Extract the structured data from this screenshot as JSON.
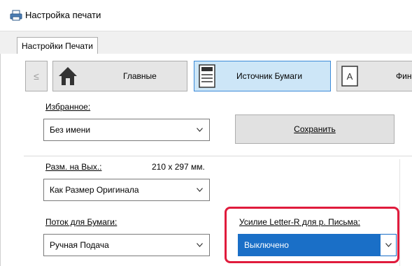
{
  "window": {
    "title": "Настройка печати",
    "icon": "printer-icon"
  },
  "tabs": [
    {
      "label": "Настройки Печати",
      "selected": true
    }
  ],
  "nav": {
    "prev_label": "≤",
    "items": [
      {
        "label": "Главные",
        "icon": "home-icon"
      },
      {
        "label": "Источник Бумаги",
        "icon": "paper-tray-icon",
        "selected": true
      },
      {
        "label": "Фин",
        "icon": "document-a-icon"
      }
    ]
  },
  "favorites": {
    "label": "Избранное:",
    "value": "Без имени",
    "save_label": "Сохранить"
  },
  "output_size": {
    "label": "Разм. на Вых.:",
    "dimensions": "210 x 297 мм.",
    "value": "Как Размер Оригинала"
  },
  "paper_flow": {
    "label": "Поток для Бумаги:",
    "value": "Ручная Подача"
  },
  "letter_r": {
    "label": "Усилие Letter-R для р. Письма:",
    "value": "Выключено"
  },
  "colors": {
    "selected_tab_bg": "#cde6f7",
    "selected_value_bg": "#1a6fc7",
    "highlight_border": "#e01b3c"
  }
}
